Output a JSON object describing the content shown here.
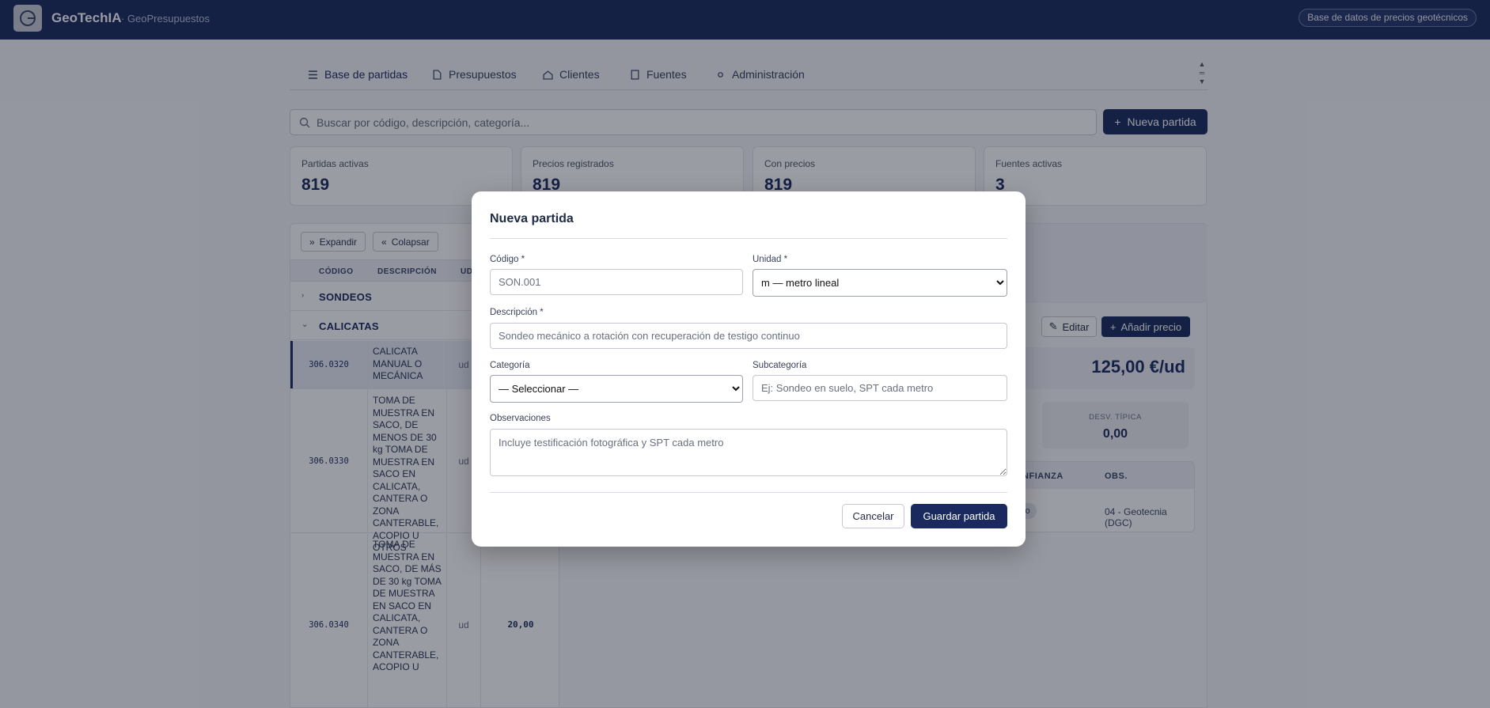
{
  "header": {
    "brand": "GeoTechIA",
    "subtitle": "· GeoPresupuestos",
    "right_button": "Base de datos de precios geotécnicos"
  },
  "tabs": [
    {
      "label": "Base de partidas",
      "icon": "list-icon",
      "active": true
    },
    {
      "label": "Presupuestos",
      "icon": "document-icon"
    },
    {
      "label": "Clientes",
      "icon": "home-icon"
    },
    {
      "label": "Fuentes",
      "icon": "book-icon"
    },
    {
      "label": "Administración",
      "icon": "gear-icon"
    }
  ],
  "search": {
    "placeholder": "Buscar por código, descripción, categoría..."
  },
  "toolbar": {
    "new_button": "Nueva partida"
  },
  "stats": [
    {
      "label": "Partidas activas",
      "value": "819"
    },
    {
      "label": "Precios registrados",
      "value": "819"
    },
    {
      "label": "Con precios",
      "value": "819"
    },
    {
      "label": "Fuentes activas",
      "value": "3"
    }
  ],
  "tree": {
    "expand": "Expandir",
    "collapse": "Colapsar",
    "columns": [
      "CÓDIGO",
      "DESCRIPCIÓN",
      "UD"
    ],
    "groups": [
      {
        "name": "SONDEOS",
        "expanded": false
      },
      {
        "name": "CALICATAS",
        "expanded": true
      }
    ],
    "rows": [
      {
        "code": "306.0320",
        "desc": "CALICATA MANUAL O MECÁNICA",
        "ud": "ud",
        "price": ""
      },
      {
        "code": "306.0330",
        "desc": "TOMA DE MUESTRA EN SACO, DE MENOS DE 30 kg TOMA DE MUESTRA EN SACO EN CALICATA, CANTERA O ZONA CANTERABLE, ACOPIO U OTROS",
        "ud": "ud",
        "price": ""
      },
      {
        "code": "306.0340",
        "desc": "TOMA DE MUESTRA EN SACO, DE MÁS DE 30 kg TOMA DE MUESTRA EN SACO EN CALICATA, CANTERA O ZONA CANTERABLE, ACOPIO U",
        "ud": "ud",
        "price": "20,00"
      }
    ]
  },
  "detail": {
    "edit": "Editar",
    "add_price": "Añadir precio",
    "price": "125,00 €/ud",
    "metric_label": "DESV. TÍPICA",
    "metric_value": "0,00",
    "src_cols": [
      "ONFIANZA",
      "OBS."
    ],
    "confidence_badge": "alto",
    "obs": "04 - Geotecnia (DGC)"
  },
  "modal": {
    "title": "Nueva partida",
    "codigo_label": "Código *",
    "codigo_placeholder": "SON.001",
    "unidad_label": "Unidad *",
    "unidad_value": "m — metro lineal",
    "descripcion_label": "Descripción *",
    "descripcion_placeholder": "Sondeo mecánico a rotación con recuperación de testigo continuo",
    "categoria_label": "Categoría",
    "categoria_value": "— Seleccionar —",
    "subcategoria_label": "Subcategoría",
    "subcategoria_placeholder": "Ej: Sondeo en suelo, SPT cada metro",
    "observaciones_label": "Observaciones",
    "observaciones_placeholder": "Incluye testificación fotográfica y SPT cada metro",
    "cancel": "Cancelar",
    "save": "Guardar partida"
  }
}
